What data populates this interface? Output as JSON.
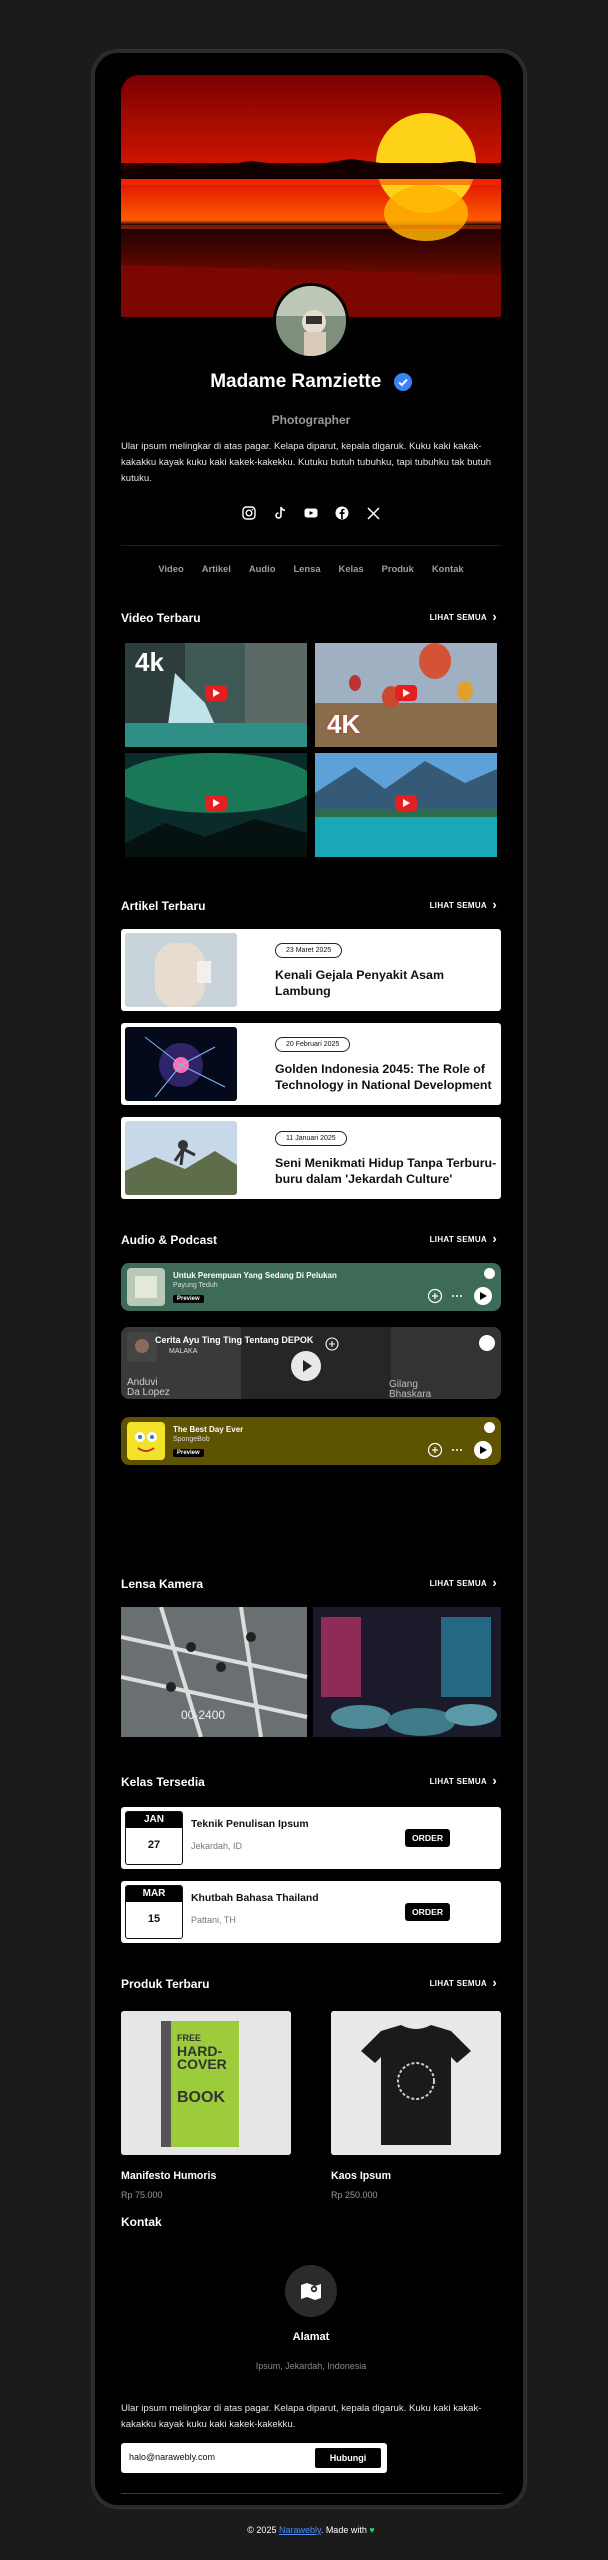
{
  "profile": {
    "name": "Madame Ramziette",
    "role": "Photographer",
    "bio": "Ular ipsum melingkar di atas pagar. Kelapa diparut, kepala digaruk. Kuku kaki kakak-kakakku kayak kuku kaki kakek-kakekku. Kutuku butuh tubuhku, tapi tubuhku tak butuh kutuku."
  },
  "socials": [
    "instagram-icon",
    "tiktok-icon",
    "youtube-icon",
    "facebook-icon",
    "x-icon"
  ],
  "nav": [
    "Video",
    "Artikel",
    "Audio",
    "Lensa",
    "Kelas",
    "Produk",
    "Kontak"
  ],
  "see_all": "LIHAT SEMUA",
  "sections": {
    "video": "Video Terbaru",
    "artikel": "Artikel Terbaru",
    "audio": "Audio & Podcast",
    "lensa": "Lensa Kamera",
    "kelas": "Kelas Tersedia",
    "produk": "Produk Terbaru",
    "kontak": "Kontak"
  },
  "videos": [
    {
      "badge": "4k"
    },
    {
      "badge": ""
    },
    {
      "badge": ""
    },
    {
      "badge": ""
    }
  ],
  "video_badges": {
    "first": "4k",
    "second": "4K"
  },
  "articles": [
    {
      "date": "23 Maret 2025",
      "title": "Kenali Gejala Penyakit Asam Lambung"
    },
    {
      "date": "20 Februari 2025",
      "title": "Golden Indonesia 2045: The Role of Technology in National Development"
    },
    {
      "date": "11 Januari 2025",
      "title": "Seni Menikmati Hidup Tanpa Terburu-buru dalam 'Jekardah Culture'"
    }
  ],
  "audio": [
    {
      "title": "Untuk Perempuan Yang Sedang Di Pelukan",
      "artist": "Payung Teduh",
      "preview": "Preview",
      "color": "#3d6b58"
    },
    {
      "title": "Cerita Ayu Ting Ting Tentang DEPOK",
      "artist": "MALAKA",
      "color": "#2a2a2a"
    },
    {
      "title": "The Best Day Ever",
      "artist": "SpongeBob",
      "preview": "Preview",
      "color": "#5e5300"
    }
  ],
  "classes": [
    {
      "month": "JAN",
      "day": "27",
      "title": "Teknik Penulisan Ipsum",
      "location": "Jekardah, ID",
      "action": "ORDER"
    },
    {
      "month": "MAR",
      "day": "15",
      "title": "Khutbah Bahasa Thailand",
      "location": "Pattani, TH",
      "action": "ORDER"
    }
  ],
  "products": [
    {
      "name": "Manifesto Humoris",
      "price": "Rp 75.000"
    },
    {
      "name": "Kaos Ipsum",
      "price": "Rp 250.000"
    }
  ],
  "book_text": {
    "l1": "FREE",
    "l2": "HARD-",
    "l3": "COVER",
    "l4": "BOOK"
  },
  "contact": {
    "label": "Alamat",
    "address": "Ipsum, Jekardah, Indonesia",
    "text": "Ular ipsum melingkar di atas pagar. Kelapa diparut, kepala digaruk. Kuku kaki kakak-kakakku kayak kuku kaki kakek-kakekku.",
    "email": "halo@narawebly.com",
    "button": "Hubungi"
  },
  "footer": {
    "prefix": "© 2025 ",
    "link": "Narawebly",
    "suffix": ". Made with "
  },
  "colors": {
    "accent": "#4c8bf5",
    "youtube": "#e41f1f",
    "heart": "#2ecc71"
  }
}
